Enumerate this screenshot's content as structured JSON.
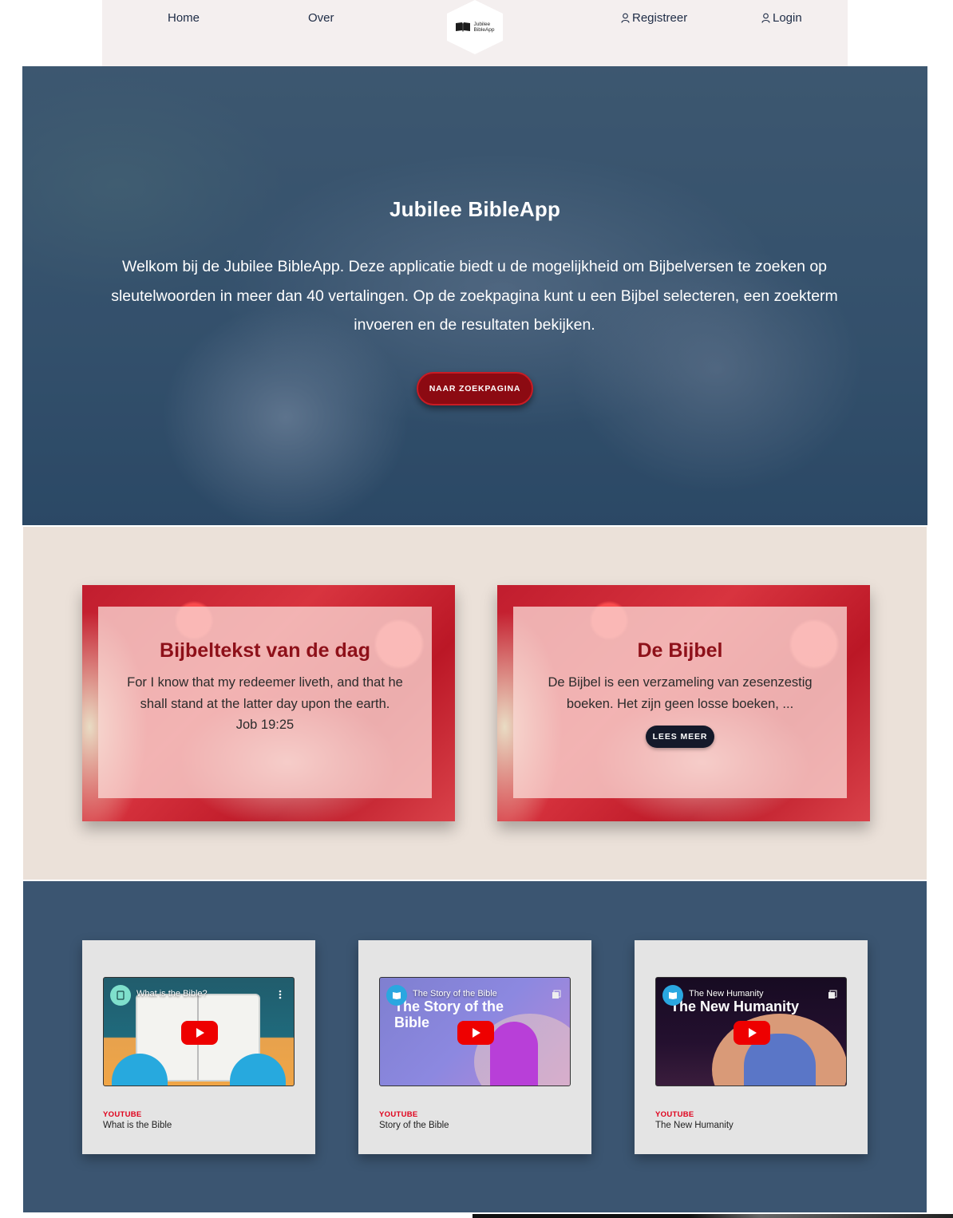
{
  "nav": {
    "home": "Home",
    "over": "Over",
    "register": "Registreer",
    "login": "Login",
    "logo_line1": "Jubilee",
    "logo_line2": "BibleApp"
  },
  "hero": {
    "title": "Jubilee BibleApp",
    "text": "Welkom bij de Jubilee BibleApp. Deze applicatie biedt u de mogelijkheid om Bijbelversen te zoeken op sleutelwoorden in meer dan 40 vertalingen. Op de zoekpagina kunt u een Bijbel selecteren, een zoekterm invoeren en de resultaten bekijken.",
    "button": "NAAR ZOEKPAGINA"
  },
  "cards": {
    "verse": {
      "title": "Bijbeltekst van de dag",
      "text": "For I know that my redeemer liveth, and that he shall stand at the latter day upon the earth.",
      "reference": "Job 19:25"
    },
    "bible": {
      "title": "De Bijbel",
      "text": "De Bijbel is een verzameling van zesenzestig boeken. Het zijn geen losse boeken, ...",
      "button": "LEES MEER"
    }
  },
  "videos": [
    {
      "embed_title": "What is the Bible?",
      "source": "YOUTUBE",
      "name": "What is the Bible"
    },
    {
      "embed_title": "The Story of the Bible",
      "thumb_text": "The Story of the Bible",
      "source": "YOUTUBE",
      "name": "Story of the Bible"
    },
    {
      "embed_title": "The New Humanity",
      "thumb_text": "The New Humanity",
      "source": "YOUTUBE",
      "name": "The New Humanity"
    }
  ],
  "colors": {
    "nav_bg": "#f4efef",
    "hero_button": "#8c0a12",
    "card_title": "#8e1019",
    "cards_bg": "#ebe1d9",
    "video_bg": "#3b5571",
    "youtube_red": "#e0001b"
  },
  "icons": [
    "user-icon",
    "bible-logo-icon",
    "play-icon",
    "more-vert-icon",
    "playlist-icon"
  ]
}
